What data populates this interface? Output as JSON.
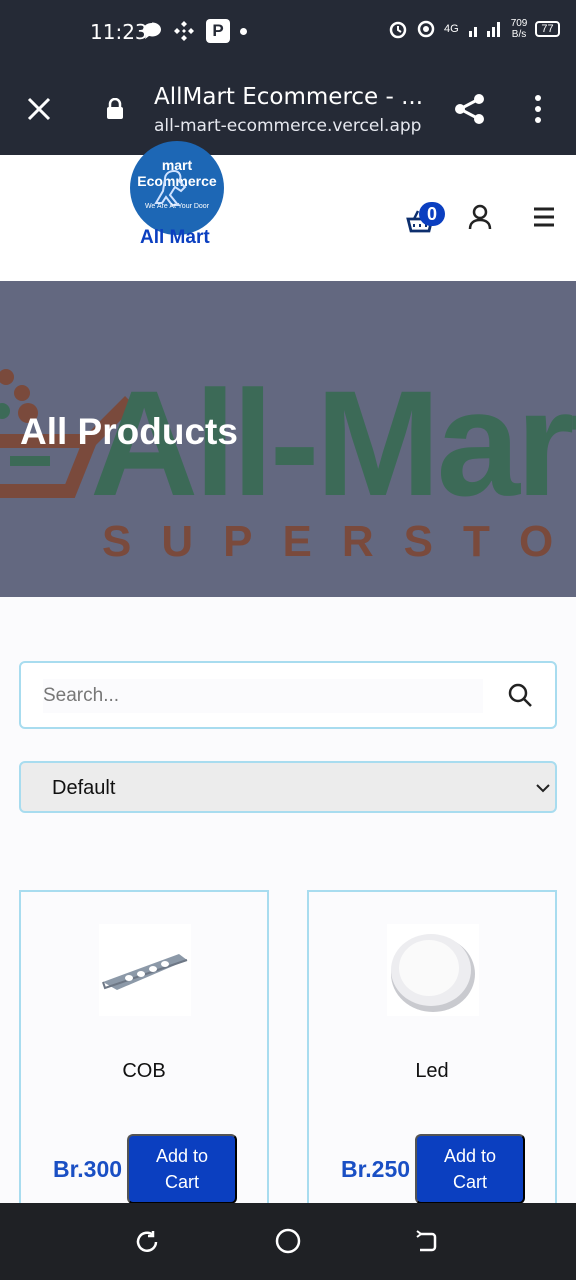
{
  "status_bar": {
    "time": "11:23",
    "speed_value": "709",
    "speed_unit": "B/s",
    "battery": "77",
    "network": "4G"
  },
  "browser": {
    "page_title": "AllMart Ecommerce - ...",
    "url": "all-mart-ecommerce.vercel.app"
  },
  "header": {
    "logo_arc_text": "mart Ecommerce",
    "logo_tagline": "We Are At Your Door",
    "logo_name": "All Mart",
    "cart_count": "0"
  },
  "hero": {
    "bg_text": "All-Mart",
    "bg_subtext": "SUPERSTORE",
    "title": "All Products"
  },
  "search": {
    "placeholder": "Search...",
    "value": ""
  },
  "sort": {
    "selected": "Default"
  },
  "products": [
    {
      "name": "COB",
      "price": "Br.300",
      "add_label": "Add to Cart"
    },
    {
      "name": "Led",
      "price": "Br.250",
      "add_label": "Add to Cart"
    }
  ],
  "colors": {
    "brand_blue": "#0b3fc0",
    "border_accent": "#a8dcef",
    "hero_overlay": "#636880",
    "browser_bar": "#252a36"
  }
}
